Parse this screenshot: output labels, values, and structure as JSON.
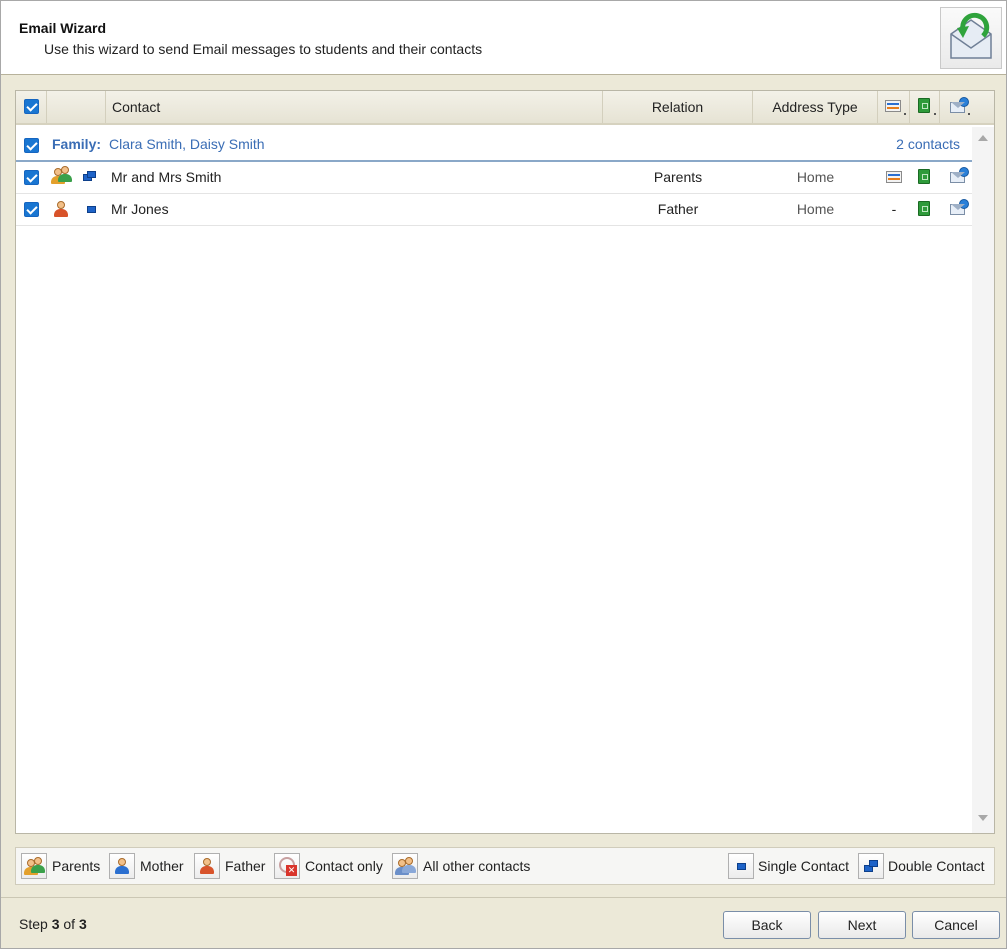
{
  "header": {
    "title": "Email Wizard",
    "subtitle": "Use this wizard to send Email messages to students and their contacts",
    "icon": "envelope-refresh-icon"
  },
  "grid": {
    "columns": {
      "contact": "Contact",
      "relation": "Relation",
      "address_type": "Address Type"
    },
    "family": {
      "label": "Family:",
      "members": "Clara Smith, Daisy Smith",
      "count": "2 contacts"
    },
    "rows": [
      {
        "contact": "Mr and Mrs Smith",
        "relation": "Parents",
        "address_type": "Home",
        "col1": "",
        "selected": true
      },
      {
        "contact": "Mr Jones",
        "relation": "Father",
        "address_type": "Home",
        "col1": "-",
        "selected": true
      }
    ]
  },
  "legend": {
    "parents": "Parents",
    "mother": "Mother",
    "father": "Father",
    "contact_only": "Contact only",
    "all_other": "All other contacts",
    "single": "Single Contact",
    "double": "Double Contact"
  },
  "footer": {
    "step_prefix": "Step ",
    "step_current": "3",
    "step_mid": " of ",
    "step_total": "3",
    "back": "Back",
    "next": "Next",
    "cancel": "Cancel"
  },
  "colors": {
    "accent": "#1976d2",
    "family_text": "#3a6db5",
    "background": "#ece9d8"
  }
}
